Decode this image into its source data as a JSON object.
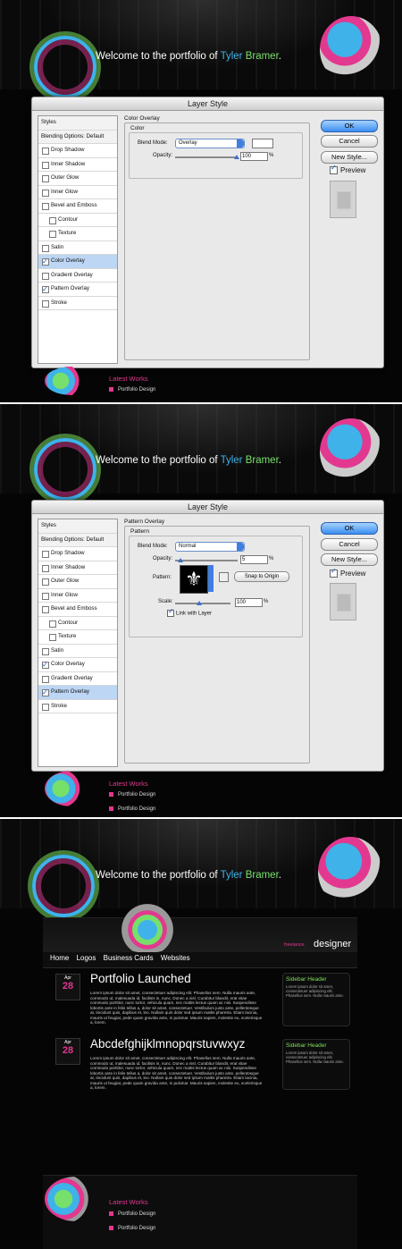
{
  "header": {
    "welcome_prefix": "Welcome to the portfolio of ",
    "first_name": "Tyler",
    "last_name": "Bramer",
    "first_name_color": "#3fb2ea",
    "last_name_color": "#77e06a"
  },
  "dialog1": {
    "title": "Layer Style",
    "styles_header": "Styles",
    "blending_options": "Blending Options: Default",
    "items": [
      {
        "label": "Drop Shadow",
        "checked": false
      },
      {
        "label": "Inner Shadow",
        "checked": false
      },
      {
        "label": "Outer Glow",
        "checked": false
      },
      {
        "label": "Inner Glow",
        "checked": false
      },
      {
        "label": "Bevel and Emboss",
        "checked": false
      },
      {
        "label": "Contour",
        "checked": false
      },
      {
        "label": "Texture",
        "checked": false
      },
      {
        "label": "Satin",
        "checked": false
      },
      {
        "label": "Color Overlay",
        "checked": true
      },
      {
        "label": "Gradient Overlay",
        "checked": false
      },
      {
        "label": "Pattern Overlay",
        "checked": true
      },
      {
        "label": "Stroke",
        "checked": false
      }
    ],
    "selected": "Color Overlay",
    "panel_title": "Color Overlay",
    "group_title": "Color",
    "blend_mode_label": "Blend Mode:",
    "blend_mode_value": "Overlay",
    "opacity_label": "Opacity:",
    "opacity_value": "100",
    "percent": "%",
    "buttons": {
      "ok": "OK",
      "cancel": "Cancel",
      "new_style": "New Style..."
    },
    "preview_label": "Preview"
  },
  "dialog2": {
    "title": "Layer Style",
    "styles_header": "Styles",
    "blending_options": "Blending Options: Default",
    "items": [
      {
        "label": "Drop Shadow",
        "checked": false
      },
      {
        "label": "Inner Shadow",
        "checked": false
      },
      {
        "label": "Outer Glow",
        "checked": false
      },
      {
        "label": "Inner Glow",
        "checked": false
      },
      {
        "label": "Bevel and Emboss",
        "checked": false
      },
      {
        "label": "Contour",
        "checked": false
      },
      {
        "label": "Texture",
        "checked": false
      },
      {
        "label": "Satin",
        "checked": false
      },
      {
        "label": "Color Overlay",
        "checked": true
      },
      {
        "label": "Gradient Overlay",
        "checked": false
      },
      {
        "label": "Pattern Overlay",
        "checked": true
      },
      {
        "label": "Stroke",
        "checked": false
      }
    ],
    "selected": "Pattern Overlay",
    "panel_title": "Pattern Overlay",
    "group_title": "Pattern",
    "blend_mode_label": "Blend Mode:",
    "blend_mode_value": "Normal",
    "opacity_label": "Opacity:",
    "opacity_value": "5",
    "pattern_label": "Pattern:",
    "snap_button": "Snap to Origin",
    "scale_label": "Scale:",
    "scale_value": "100",
    "link_label": "Link with Layer",
    "percent": "%",
    "buttons": {
      "ok": "OK",
      "cancel": "Cancel",
      "new_style": "New Style..."
    },
    "preview_label": "Preview"
  },
  "footer1": {
    "latest_works": "Latest Works",
    "portfolio_design": "Portfolio Design"
  },
  "footer2": {
    "latest_works": "Latest Works",
    "logo_design": "Portfolio Design",
    "portfolio_design": "Portfolio Design"
  },
  "site": {
    "freelance": "freelance",
    "designer": "designer",
    "nav": [
      "Home",
      "Logos",
      "Business Cards",
      "Websites"
    ],
    "posts": [
      {
        "month": "Apr",
        "day": "28",
        "title": "Portfolio Launched",
        "body": "Lorem ipsum dolor sit amet, consectetuer adipiscing elit. Phasellus sem. Nulla mauris ante, commodo ut, malesuada id, facilisis in, nunc. Donec a nisl. Curabitur blandit, erat vitae commodo porttitor, nunc tortor, vehicula quam, nec mattis lectus quam ac nisi. Suspendisse lobortis ante in felis tellus a, dolor sit amet, consectetuer. Vestibulum justo ante, pellentesque at, tincidunt quis, dapibus et, leo. Nullam quis dolor sed ipsum mattis pharetra. Etiam lacinia, mauris ut feugiat, pede quam gravida ante, in pulvinar. Mauris sapien, molestie eu, scelerisque a, lorem."
      },
      {
        "month": "Apr",
        "day": "28",
        "title": "Abcdefghijklmnopqrstuvwxyz",
        "body": "Lorem ipsum dolor sit amet, consectetuer adipiscing elit. Phasellus sem. Nulla mauris ante, commodo ut, malesuada id, facilisis in, nunc. Donec a nisl. Curabitur blandit, erat vitae commodo porttitor, nunc tortor, vehicula quam, nec mattis lectus quam ac nisi. Suspendisse lobortis ante in felis tellus a, dolor sit amet, consectetuer. Vestibulum justo ante, pellentesque at, tincidunt quis, dapibus et, leo. Nullam quis dolor sed ipsum mattis pharetra. Etiam lacinia, mauris ut feugiat, pede quam gravida ante, in pulvinar. Mauris sapien, molestie eu, scelerisque a, lorem."
      }
    ],
    "sidebars": [
      {
        "title": "Sidebar Header",
        "text": "Lorem ipsum dolor sit amet, consectetuer adipiscing elit. Phasellus sem. Nulla mauris ante."
      },
      {
        "title": "Sidebar Header",
        "text": "Lorem ipsum dolor sit amet, consectetuer adipiscing elit. Phasellus sem. Nulla mauris ante."
      }
    ],
    "latest_works": "Latest Works",
    "logo_design": "Portfolio Design",
    "portfolio_design": "Portfolio Design"
  }
}
